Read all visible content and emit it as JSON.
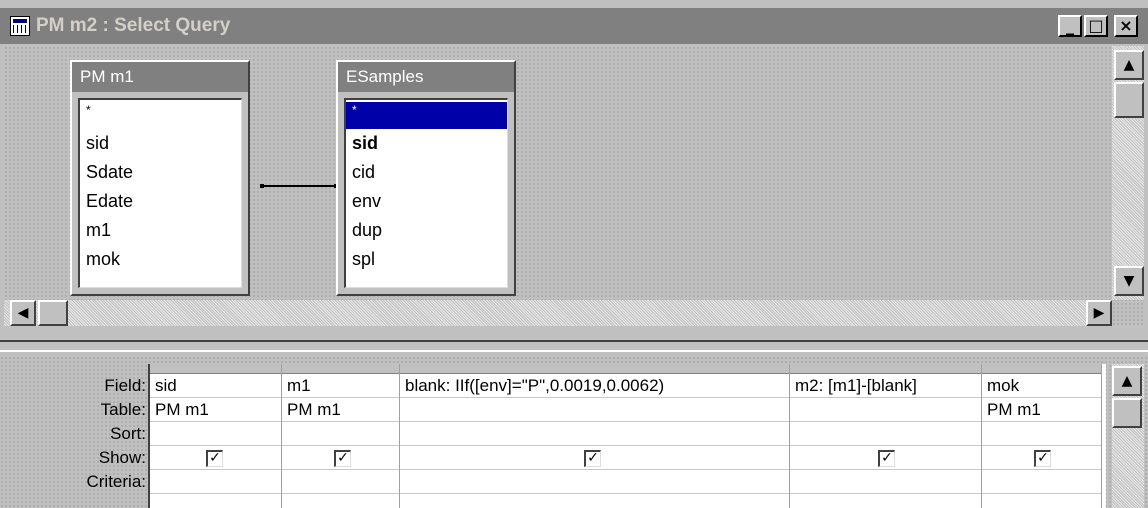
{
  "window": {
    "title": "PM m2 : Select Query",
    "minimize_label": "_",
    "maximize_label": "□",
    "close_label": "×"
  },
  "tables": [
    {
      "name": "PM m1",
      "fields": [
        "*",
        "sid",
        "Sdate",
        "Edate",
        "m1",
        "mok"
      ]
    },
    {
      "name": "ESamples",
      "fields": [
        "*",
        "sid",
        "cid",
        "env",
        "dup",
        "spl"
      ],
      "selected_field": "*",
      "bold_field": "sid"
    }
  ],
  "grid": {
    "row_labels": [
      "Field:",
      "Table:",
      "Sort:",
      "Show:",
      "Criteria:"
    ],
    "columns": [
      {
        "field": "sid",
        "table": "PM m1",
        "sort": "",
        "show": true
      },
      {
        "field": "m1",
        "table": "PM m1",
        "sort": "",
        "show": true
      },
      {
        "field": "blank: IIf([env]=\"P\",0.0019,0.0062)",
        "table": "",
        "sort": "",
        "show": true
      },
      {
        "field": "m2: [m1]-[blank]",
        "table": "",
        "sort": "",
        "show": true
      },
      {
        "field": "mok",
        "table": "PM m1",
        "sort": "",
        "show": true
      }
    ],
    "checkmark": "✓"
  },
  "scroll_glyphs": {
    "up": "▲",
    "down": "▼",
    "left": "◀",
    "right": "▶"
  },
  "colors": {
    "title_bar": "#808080",
    "selection": "#0000a8",
    "face": "#c0c0c0"
  }
}
